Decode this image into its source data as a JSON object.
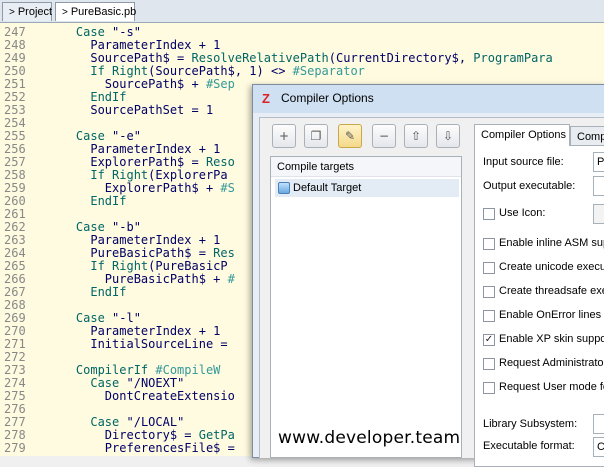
{
  "tabs": [
    {
      "arrow": ">",
      "label": "Project"
    },
    {
      "arrow": ">",
      "label": "PureBasic.pb"
    }
  ],
  "editor": {
    "lines": [
      {
        "num": "247",
        "segs": [
          {
            "t": "    "
          },
          {
            "t": "Case",
            "k": "kw"
          },
          {
            "t": " \"-s\"",
            "k": "tx"
          }
        ]
      },
      {
        "num": "248",
        "segs": [
          {
            "t": "      ParameterIndex + 1",
            "k": "tx"
          }
        ]
      },
      {
        "num": "249",
        "segs": [
          {
            "t": "      SourcePath$ = ",
            "k": "tx"
          },
          {
            "t": "ResolveRelativePath",
            "k": "kw"
          },
          {
            "t": "(CurrentDirectory$, ",
            "k": "tx"
          },
          {
            "t": "ProgramPara",
            "k": "kw"
          }
        ]
      },
      {
        "num": "250",
        "segs": [
          {
            "t": "      "
          },
          {
            "t": "If Right",
            "k": "kw"
          },
          {
            "t": "(SourcePath$, 1) <> ",
            "k": "tx"
          },
          {
            "t": "#Separator",
            "k": "cm"
          }
        ]
      },
      {
        "num": "251",
        "segs": [
          {
            "t": "        SourcePath$ + ",
            "k": "tx"
          },
          {
            "t": "#Sep",
            "k": "cm"
          }
        ]
      },
      {
        "num": "252",
        "segs": [
          {
            "t": "      "
          },
          {
            "t": "EndIf",
            "k": "kw"
          }
        ]
      },
      {
        "num": "253",
        "segs": [
          {
            "t": "      SourcePathSet = 1",
            "k": "tx"
          }
        ]
      },
      {
        "num": "254",
        "segs": []
      },
      {
        "num": "255",
        "segs": [
          {
            "t": "    "
          },
          {
            "t": "Case",
            "k": "kw"
          },
          {
            "t": " \"-e\"",
            "k": "tx"
          }
        ]
      },
      {
        "num": "256",
        "segs": [
          {
            "t": "      ParameterIndex + 1",
            "k": "tx"
          }
        ]
      },
      {
        "num": "257",
        "segs": [
          {
            "t": "      ExplorerPath$ = ",
            "k": "tx"
          },
          {
            "t": "Reso",
            "k": "kw"
          }
        ]
      },
      {
        "num": "258",
        "segs": [
          {
            "t": "      "
          },
          {
            "t": "If Right",
            "k": "kw"
          },
          {
            "t": "(ExplorerPa",
            "k": "tx"
          }
        ]
      },
      {
        "num": "259",
        "segs": [
          {
            "t": "        ExplorerPath$ + ",
            "k": "tx"
          },
          {
            "t": "#S",
            "k": "cm"
          }
        ]
      },
      {
        "num": "260",
        "segs": [
          {
            "t": "      "
          },
          {
            "t": "EndIf",
            "k": "kw"
          }
        ]
      },
      {
        "num": "261",
        "segs": []
      },
      {
        "num": "262",
        "segs": [
          {
            "t": "    "
          },
          {
            "t": "Case",
            "k": "kw"
          },
          {
            "t": " \"-b\"",
            "k": "tx"
          }
        ]
      },
      {
        "num": "263",
        "segs": [
          {
            "t": "      ParameterIndex + 1",
            "k": "tx"
          }
        ]
      },
      {
        "num": "264",
        "segs": [
          {
            "t": "      PureBasicPath$ = ",
            "k": "tx"
          },
          {
            "t": "Res",
            "k": "kw"
          }
        ]
      },
      {
        "num": "265",
        "segs": [
          {
            "t": "      "
          },
          {
            "t": "If Right",
            "k": "kw"
          },
          {
            "t": "(PureBasicP",
            "k": "tx"
          }
        ]
      },
      {
        "num": "266",
        "segs": [
          {
            "t": "        PureBasicPath$ + ",
            "k": "tx"
          },
          {
            "t": "#",
            "k": "cm"
          }
        ]
      },
      {
        "num": "267",
        "segs": [
          {
            "t": "      "
          },
          {
            "t": "EndIf",
            "k": "kw"
          }
        ]
      },
      {
        "num": "268",
        "segs": []
      },
      {
        "num": "269",
        "segs": [
          {
            "t": "    "
          },
          {
            "t": "Case",
            "k": "kw"
          },
          {
            "t": " \"-l\"",
            "k": "tx"
          }
        ]
      },
      {
        "num": "270",
        "segs": [
          {
            "t": "      ParameterIndex + 1",
            "k": "tx"
          }
        ]
      },
      {
        "num": "271",
        "segs": [
          {
            "t": "      InitialSourceLine = ",
            "k": "tx"
          }
        ]
      },
      {
        "num": "272",
        "segs": []
      },
      {
        "num": "273",
        "segs": [
          {
            "t": "    "
          },
          {
            "t": "CompilerIf",
            "k": "kw"
          },
          {
            "t": " #CompileW",
            "k": "cm"
          }
        ]
      },
      {
        "num": "274",
        "segs": [
          {
            "t": "      "
          },
          {
            "t": "Case",
            "k": "kw"
          },
          {
            "t": " \"/NOEXT\"",
            "k": "tx"
          }
        ]
      },
      {
        "num": "275",
        "segs": [
          {
            "t": "        DontCreateExtensio",
            "k": "tx"
          }
        ]
      },
      {
        "num": "276",
        "segs": []
      },
      {
        "num": "277",
        "segs": [
          {
            "t": "      "
          },
          {
            "t": "Case",
            "k": "kw"
          },
          {
            "t": " \"/LOCAL\"",
            "k": "tx"
          }
        ]
      },
      {
        "num": "278",
        "segs": [
          {
            "t": "        Directory$ = ",
            "k": "tx"
          },
          {
            "t": "GetPa",
            "k": "kw"
          }
        ]
      },
      {
        "num": "279",
        "segs": [
          {
            "t": "        PreferencesFile$ = ",
            "k": "tx"
          }
        ]
      }
    ]
  },
  "dialog": {
    "title": "Compiler Options",
    "toolbar": [
      {
        "glyph": "+",
        "name": "new-target-icon"
      },
      {
        "glyph": "❐",
        "name": "copy-target-icon"
      },
      {
        "glyph": "✎",
        "name": "edit-target-icon"
      },
      {
        "glyph": "−",
        "name": "remove-target-icon"
      },
      {
        "glyph": "⇧",
        "name": "move-up-icon"
      },
      {
        "glyph": "⇩",
        "name": "move-down-icon"
      }
    ],
    "targets_header": "Compile targets",
    "targets": [
      "Default Target"
    ],
    "tabs": [
      "Compiler Options",
      "Compile"
    ],
    "fields": {
      "input_source_label": "Input source file:",
      "input_source_value": "Pur",
      "output_exe_label": "Output executable:",
      "output_exe_value": "",
      "use_icon_label": "Use Icon:",
      "use_icon_value": "",
      "library_subsystem_label": "Library Subsystem:",
      "library_subsystem_value": "",
      "executable_format_label": "Executable format:",
      "executable_format_value": "Co"
    },
    "checkboxes": [
      {
        "label": "Enable inline ASM sup",
        "checked": false
      },
      {
        "label": "Create unicode execu",
        "checked": false
      },
      {
        "label": "Create threadsafe exe",
        "checked": false
      },
      {
        "label": "Enable OnError lines s",
        "checked": false
      },
      {
        "label": "Enable XP skin suppo",
        "checked": true
      },
      {
        "label": "Request Administrator",
        "checked": false
      },
      {
        "label": "Request User mode fo",
        "checked": false
      }
    ]
  },
  "watermark": "www.developer.team"
}
